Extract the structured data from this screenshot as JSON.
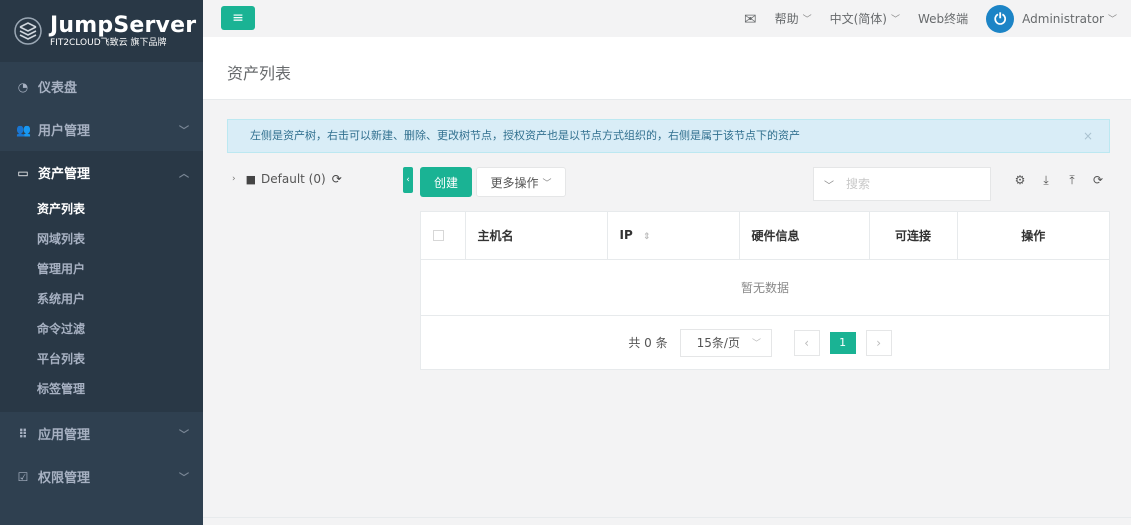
{
  "sidebar": {
    "brand_title": "JumpServer",
    "brand_sub": "FIT2CLOUD飞致云 旗下品牌",
    "items": [
      {
        "label": "仪表盘",
        "icon": "dashboard-icon"
      },
      {
        "label": "用户管理",
        "icon": "users-icon"
      },
      {
        "label": "资产管理",
        "icon": "inbox-icon"
      },
      {
        "label": "应用管理",
        "icon": "grid-icon"
      },
      {
        "label": "权限管理",
        "icon": "edit-icon"
      }
    ],
    "sub_items": [
      "资产列表",
      "网域列表",
      "管理用户",
      "系统用户",
      "命令过滤",
      "平台列表",
      "标签管理"
    ]
  },
  "topbar": {
    "help": "帮助",
    "language": "中文(简体)",
    "web_terminal": "Web终端",
    "user": "Administrator"
  },
  "page": {
    "title": "资产列表",
    "alert": "左侧是资产树，右击可以新建、删除、更改树节点，授权资产也是以节点方式组织的，右侧是属于该节点下的资产"
  },
  "tree": {
    "node_label": "Default (0)"
  },
  "toolbar": {
    "create_label": "创建",
    "more_label": "更多操作",
    "search_placeholder": "搜索"
  },
  "table": {
    "columns": [
      "主机名",
      "IP",
      "硬件信息",
      "可连接",
      "操作"
    ],
    "empty_text": "暂无数据"
  },
  "pagination": {
    "total_text": "共 0 条",
    "page_size": "15条/页",
    "current_page": "1"
  },
  "colors": {
    "accent": "#1ab394",
    "sidebar": "#2f4050"
  }
}
